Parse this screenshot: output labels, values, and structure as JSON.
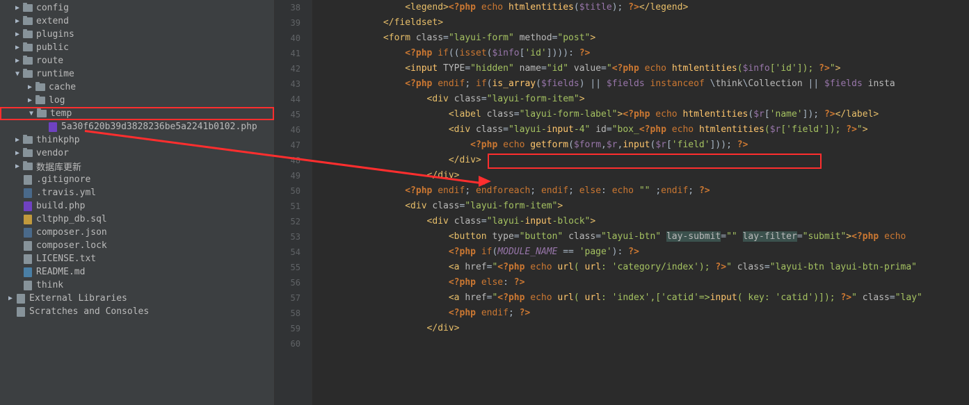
{
  "tree": {
    "config": "config",
    "extend": "extend",
    "plugins": "plugins",
    "public": "public",
    "route": "route",
    "runtime": "runtime",
    "cache": "cache",
    "log": "log",
    "temp": "temp",
    "tempfile": "5a30f620b39d3828236be5a2241b0102.php",
    "thinkphp": "thinkphp",
    "vendor": "vendor",
    "dbupdate": "数据库更新",
    "gitignore": ".gitignore",
    "travis": ".travis.yml",
    "build": "build.php",
    "dbsql": "cltphp_db.sql",
    "composerjson": "composer.json",
    "composerlock": "composer.lock",
    "license": "LICENSE.txt",
    "readme": "README.md",
    "think": "think",
    "extlib": "External Libraries",
    "scratch": "Scratches and Consoles"
  },
  "lines": [
    "38",
    "39",
    "40",
    "41",
    "42",
    "43",
    "44",
    "45",
    "46",
    "47",
    "48",
    "49",
    "50",
    "51",
    "52",
    "53",
    "54",
    "55",
    "56",
    "57",
    "58",
    "59",
    "60"
  ],
  "chart_data": {
    "type": "code",
    "language": "php-html",
    "annotations": {
      "red_arrow": {
        "from": "sidebar folder 'temp'",
        "to": "code line 48"
      },
      "red_box_code": "<?php echo getform($form,$r,input($r['field'])); ?>"
    },
    "raw_lines": [
      "                <legend><?php echo htmlentities($title); ?></legend>",
      "            </fieldset>",
      "            <form class=\"layui-form\" method=\"post\">",
      "                <?php if((isset($info['id']))): ?>",
      "                <input TYPE=\"hidden\" name=\"id\" value=\"<?php echo htmlentities($info['id']); ?>\">",
      "                <?php endif; if(is_array($fields) || $fields instanceof \\think\\Collection || $fields insta",
      "                    <div class=\"layui-form-item\">",
      "                        <label class=\"layui-form-label\"><?php echo htmlentities($r['name']); ?></label>",
      "                        <div class=\"layui-input-4\" id=\"box_<?php echo htmlentities($r['field']); ?>\">",
      "                            <?php echo getform($form,$r,input($r['field'])); ?>",
      "                        </div>",
      "                    </div>",
      "                <?php endif; endforeach; endif; else: echo \"\" ;endif; ?>",
      "                <div class=\"layui-form-item\">",
      "                    <div class=\"layui-input-block\">",
      "                        <button type=\"button\" class=\"layui-btn\" lay-submit=\"\" lay-filter=\"submit\"><?php echo",
      "                        <?php if(MODULE_NAME == 'page'): ?>",
      "                        <a href=\"<?php echo url( url: 'category/index'); ?>\" class=\"layui-btn layui-btn-prima",
      "                        <?php else: ?>",
      "                        <a href=\"<?php echo url( url: 'index',['catid'=>input( key: 'catid')]); ?>\" class=\"lay",
      "                        <?php endif; ?>",
      "                    </div>"
    ]
  }
}
